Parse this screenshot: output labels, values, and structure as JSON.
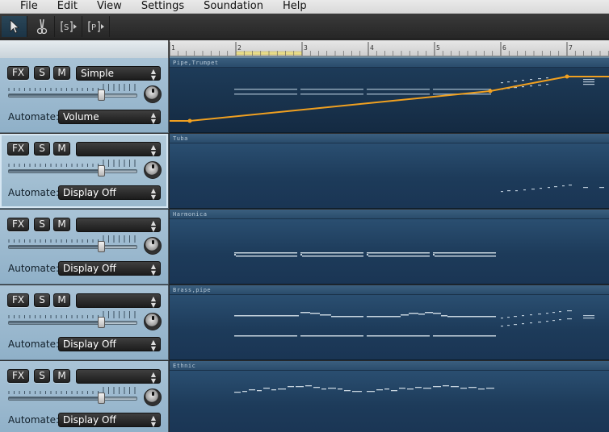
{
  "menu": [
    "File",
    "Edit",
    "View",
    "Settings",
    "Soundation",
    "Help"
  ],
  "toolbar": {
    "tools": [
      {
        "name": "pointer-tool",
        "icon": "arrow-pointer-icon",
        "active": true
      },
      {
        "name": "scissors-tool",
        "icon": "scissors-icon",
        "active": false
      },
      {
        "name": "s-bracket-tool",
        "icon": "s-bracket-icon",
        "active": false
      },
      {
        "name": "p-bracket-tool",
        "icon": "p-bracket-icon",
        "active": false
      }
    ]
  },
  "ruler": {
    "marks": [
      "1",
      "2",
      "3",
      "4",
      "5",
      "6",
      "7"
    ]
  },
  "tracks": [
    {
      "lane_name": "Pipe,Trumpet",
      "fx": "FX",
      "solo": "S",
      "mute": "M",
      "instrument": "Simple",
      "automate_label": "Automate:",
      "automate_value": "Volume",
      "volume": 0.72,
      "selected": false
    },
    {
      "lane_name": "Tuba",
      "fx": "FX",
      "solo": "S",
      "mute": "M",
      "instrument": "",
      "automate_label": "Automate:",
      "automate_value": "Display Off",
      "volume": 0.72,
      "selected": true
    },
    {
      "lane_name": "Harmonica",
      "fx": "FX",
      "solo": "S",
      "mute": "M",
      "instrument": "",
      "automate_label": "Automate:",
      "automate_value": "Display Off",
      "volume": 0.72,
      "selected": false
    },
    {
      "lane_name": "Brass,pipe",
      "fx": "FX",
      "solo": "S",
      "mute": "M",
      "instrument": "",
      "automate_label": "Automate:",
      "automate_value": "Display Off",
      "volume": 0.72,
      "selected": false
    },
    {
      "lane_name": "Ethnic",
      "fx": "FX",
      "solo": "S",
      "mute": "M",
      "instrument": "",
      "automate_label": "Automate:",
      "automate_value": "Display Off",
      "volume": 0.72,
      "selected": false
    }
  ],
  "colors": {
    "automation_line": "#f0a020",
    "note": "#d8e4ee",
    "lane_bg": "#234668"
  }
}
